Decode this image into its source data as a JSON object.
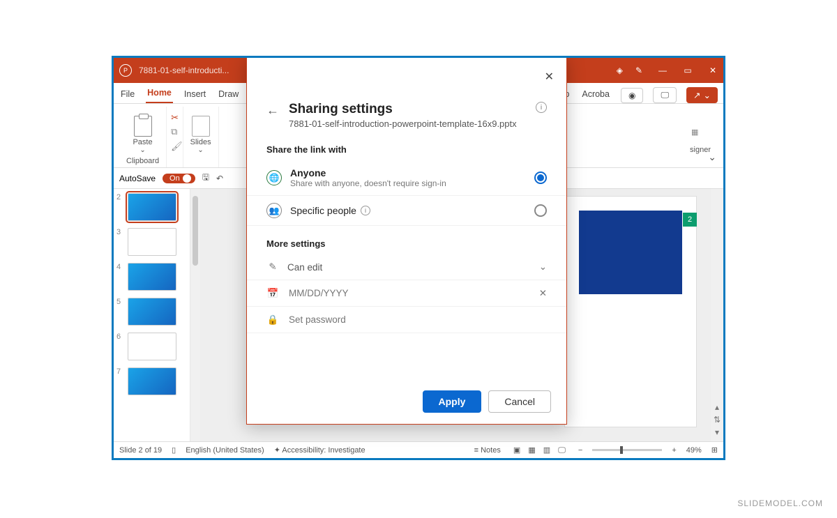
{
  "titlebar": {
    "filename": "7881-01-self-introducti..."
  },
  "tabs": {
    "file": "File",
    "home": "Home",
    "insert": "Insert",
    "draw": "Draw",
    "help_partial": "p",
    "acrobat": "Acroba",
    "share_caret": "⌄"
  },
  "ribbon": {
    "paste": "Paste",
    "slides": "Slides",
    "clipboard_label": "Clipboard",
    "designer_partial": "signer"
  },
  "qat": {
    "autosave": "AutoSave",
    "autosave_state": "On"
  },
  "thumbs": {
    "nums": [
      "2",
      "3",
      "4",
      "5",
      "6",
      "7"
    ]
  },
  "canvas": {
    "badge": "2"
  },
  "status": {
    "slide": "Slide 2 of 19",
    "lang": "English (United States)",
    "accessibility": "Accessibility: Investigate",
    "notes": "Notes",
    "zoom": "49%"
  },
  "dialog": {
    "title": "Sharing settings",
    "filename": "7881-01-self-introduction-powerpoint-template-16x9.pptx",
    "share_section": "Share the link with",
    "anyone": {
      "label": "Anyone",
      "sub": "Share with anyone, doesn't require sign-in"
    },
    "specific": {
      "label": "Specific people"
    },
    "more_section": "More settings",
    "can_edit": "Can edit",
    "date_placeholder": "MM/DD/YYYY",
    "password_placeholder": "Set password",
    "apply": "Apply",
    "cancel": "Cancel"
  },
  "watermark": "SLIDEMODEL.COM"
}
